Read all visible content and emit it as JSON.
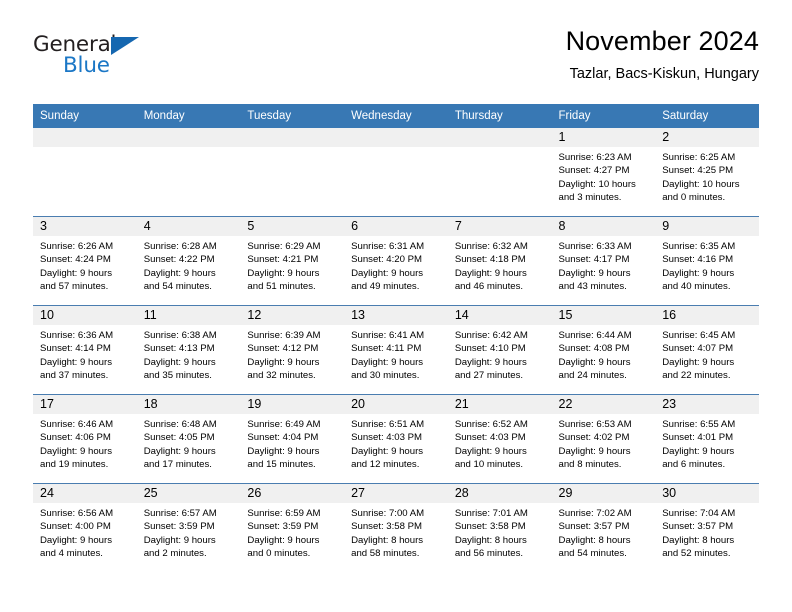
{
  "brand": {
    "name_part1": "General",
    "name_part2": "Blue",
    "accent_color": "#1b77c6",
    "triangle_color": "#1567b0"
  },
  "header": {
    "title": "November 2024",
    "subtitle": "Tazlar, Bacs-Kiskun, Hungary"
  },
  "calendar": {
    "header_bg": "#3878b4",
    "daynum_band_bg": "#f0f0f0",
    "weekdays": [
      "Sunday",
      "Monday",
      "Tuesday",
      "Wednesday",
      "Thursday",
      "Friday",
      "Saturday"
    ],
    "weeks": [
      [
        {
          "day": "",
          "empty": true,
          "lines": []
        },
        {
          "day": "",
          "empty": true,
          "lines": []
        },
        {
          "day": "",
          "empty": true,
          "lines": []
        },
        {
          "day": "",
          "empty": true,
          "lines": []
        },
        {
          "day": "",
          "empty": true,
          "lines": []
        },
        {
          "day": "1",
          "empty": false,
          "lines": [
            "Sunrise: 6:23 AM",
            "Sunset: 4:27 PM",
            "Daylight: 10 hours",
            "and 3 minutes."
          ]
        },
        {
          "day": "2",
          "empty": false,
          "lines": [
            "Sunrise: 6:25 AM",
            "Sunset: 4:25 PM",
            "Daylight: 10 hours",
            "and 0 minutes."
          ]
        }
      ],
      [
        {
          "day": "3",
          "empty": false,
          "lines": [
            "Sunrise: 6:26 AM",
            "Sunset: 4:24 PM",
            "Daylight: 9 hours",
            "and 57 minutes."
          ]
        },
        {
          "day": "4",
          "empty": false,
          "lines": [
            "Sunrise: 6:28 AM",
            "Sunset: 4:22 PM",
            "Daylight: 9 hours",
            "and 54 minutes."
          ]
        },
        {
          "day": "5",
          "empty": false,
          "lines": [
            "Sunrise: 6:29 AM",
            "Sunset: 4:21 PM",
            "Daylight: 9 hours",
            "and 51 minutes."
          ]
        },
        {
          "day": "6",
          "empty": false,
          "lines": [
            "Sunrise: 6:31 AM",
            "Sunset: 4:20 PM",
            "Daylight: 9 hours",
            "and 49 minutes."
          ]
        },
        {
          "day": "7",
          "empty": false,
          "lines": [
            "Sunrise: 6:32 AM",
            "Sunset: 4:18 PM",
            "Daylight: 9 hours",
            "and 46 minutes."
          ]
        },
        {
          "day": "8",
          "empty": false,
          "lines": [
            "Sunrise: 6:33 AM",
            "Sunset: 4:17 PM",
            "Daylight: 9 hours",
            "and 43 minutes."
          ]
        },
        {
          "day": "9",
          "empty": false,
          "lines": [
            "Sunrise: 6:35 AM",
            "Sunset: 4:16 PM",
            "Daylight: 9 hours",
            "and 40 minutes."
          ]
        }
      ],
      [
        {
          "day": "10",
          "empty": false,
          "lines": [
            "Sunrise: 6:36 AM",
            "Sunset: 4:14 PM",
            "Daylight: 9 hours",
            "and 37 minutes."
          ]
        },
        {
          "day": "11",
          "empty": false,
          "lines": [
            "Sunrise: 6:38 AM",
            "Sunset: 4:13 PM",
            "Daylight: 9 hours",
            "and 35 minutes."
          ]
        },
        {
          "day": "12",
          "empty": false,
          "lines": [
            "Sunrise: 6:39 AM",
            "Sunset: 4:12 PM",
            "Daylight: 9 hours",
            "and 32 minutes."
          ]
        },
        {
          "day": "13",
          "empty": false,
          "lines": [
            "Sunrise: 6:41 AM",
            "Sunset: 4:11 PM",
            "Daylight: 9 hours",
            "and 30 minutes."
          ]
        },
        {
          "day": "14",
          "empty": false,
          "lines": [
            "Sunrise: 6:42 AM",
            "Sunset: 4:10 PM",
            "Daylight: 9 hours",
            "and 27 minutes."
          ]
        },
        {
          "day": "15",
          "empty": false,
          "lines": [
            "Sunrise: 6:44 AM",
            "Sunset: 4:08 PM",
            "Daylight: 9 hours",
            "and 24 minutes."
          ]
        },
        {
          "day": "16",
          "empty": false,
          "lines": [
            "Sunrise: 6:45 AM",
            "Sunset: 4:07 PM",
            "Daylight: 9 hours",
            "and 22 minutes."
          ]
        }
      ],
      [
        {
          "day": "17",
          "empty": false,
          "lines": [
            "Sunrise: 6:46 AM",
            "Sunset: 4:06 PM",
            "Daylight: 9 hours",
            "and 19 minutes."
          ]
        },
        {
          "day": "18",
          "empty": false,
          "lines": [
            "Sunrise: 6:48 AM",
            "Sunset: 4:05 PM",
            "Daylight: 9 hours",
            "and 17 minutes."
          ]
        },
        {
          "day": "19",
          "empty": false,
          "lines": [
            "Sunrise: 6:49 AM",
            "Sunset: 4:04 PM",
            "Daylight: 9 hours",
            "and 15 minutes."
          ]
        },
        {
          "day": "20",
          "empty": false,
          "lines": [
            "Sunrise: 6:51 AM",
            "Sunset: 4:03 PM",
            "Daylight: 9 hours",
            "and 12 minutes."
          ]
        },
        {
          "day": "21",
          "empty": false,
          "lines": [
            "Sunrise: 6:52 AM",
            "Sunset: 4:03 PM",
            "Daylight: 9 hours",
            "and 10 minutes."
          ]
        },
        {
          "day": "22",
          "empty": false,
          "lines": [
            "Sunrise: 6:53 AM",
            "Sunset: 4:02 PM",
            "Daylight: 9 hours",
            "and 8 minutes."
          ]
        },
        {
          "day": "23",
          "empty": false,
          "lines": [
            "Sunrise: 6:55 AM",
            "Sunset: 4:01 PM",
            "Daylight: 9 hours",
            "and 6 minutes."
          ]
        }
      ],
      [
        {
          "day": "24",
          "empty": false,
          "lines": [
            "Sunrise: 6:56 AM",
            "Sunset: 4:00 PM",
            "Daylight: 9 hours",
            "and 4 minutes."
          ]
        },
        {
          "day": "25",
          "empty": false,
          "lines": [
            "Sunrise: 6:57 AM",
            "Sunset: 3:59 PM",
            "Daylight: 9 hours",
            "and 2 minutes."
          ]
        },
        {
          "day": "26",
          "empty": false,
          "lines": [
            "Sunrise: 6:59 AM",
            "Sunset: 3:59 PM",
            "Daylight: 9 hours",
            "and 0 minutes."
          ]
        },
        {
          "day": "27",
          "empty": false,
          "lines": [
            "Sunrise: 7:00 AM",
            "Sunset: 3:58 PM",
            "Daylight: 8 hours",
            "and 58 minutes."
          ]
        },
        {
          "day": "28",
          "empty": false,
          "lines": [
            "Sunrise: 7:01 AM",
            "Sunset: 3:58 PM",
            "Daylight: 8 hours",
            "and 56 minutes."
          ]
        },
        {
          "day": "29",
          "empty": false,
          "lines": [
            "Sunrise: 7:02 AM",
            "Sunset: 3:57 PM",
            "Daylight: 8 hours",
            "and 54 minutes."
          ]
        },
        {
          "day": "30",
          "empty": false,
          "lines": [
            "Sunrise: 7:04 AM",
            "Sunset: 3:57 PM",
            "Daylight: 8 hours",
            "and 52 minutes."
          ]
        }
      ]
    ]
  }
}
